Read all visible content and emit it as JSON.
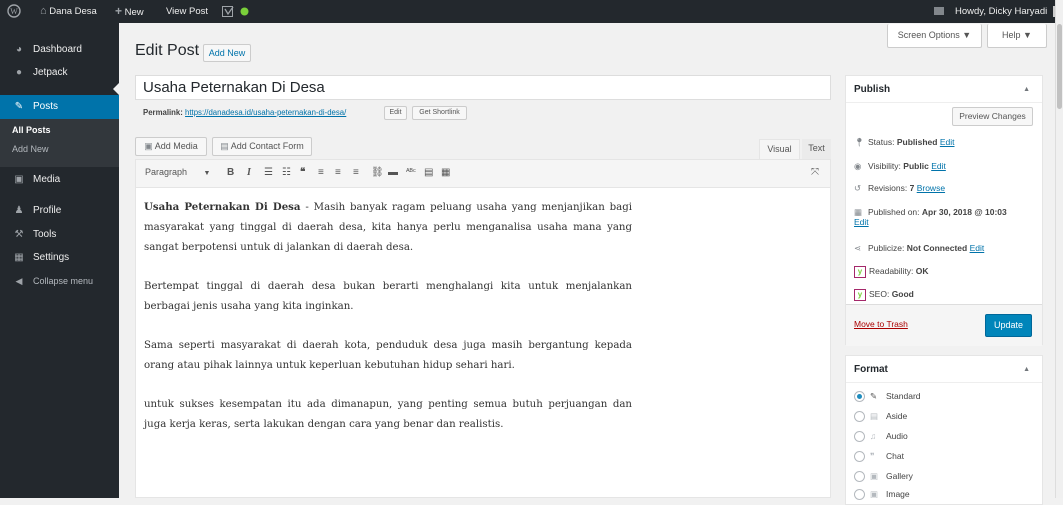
{
  "admin_bar": {
    "site_name": "Dana Desa",
    "new_label": "New",
    "view_post_label": "View Post",
    "greeting": "Howdy, Dicky Haryadi"
  },
  "sidebar": {
    "items": [
      {
        "label": "Dashboard",
        "icon": "dashboard-icon"
      },
      {
        "label": "Jetpack",
        "icon": "jetpack-icon"
      },
      {
        "label": "Posts",
        "icon": "pin-icon"
      },
      {
        "label": "Media",
        "icon": "media-icon"
      },
      {
        "label": "Profile",
        "icon": "user-icon"
      },
      {
        "label": "Tools",
        "icon": "wrench-icon"
      },
      {
        "label": "Settings",
        "icon": "settings-icon"
      },
      {
        "label": "Collapse menu",
        "icon": "collapse-icon"
      }
    ],
    "submenu": [
      "All Posts",
      "Add New"
    ]
  },
  "header": {
    "screen_options": "Screen Options ▼",
    "help": "Help ▼",
    "page_title": "Edit Post",
    "add_new": "Add New"
  },
  "post": {
    "title": "Usaha Peternakan Di Desa",
    "permalink_label": "Permalink:",
    "permalink_url": "https://danadesa.id/usaha-peternakan-di-desa/",
    "edit_label": "Edit",
    "shortlink_label": "Get Shortlink"
  },
  "editor": {
    "add_media": "Add Media",
    "add_contact_form": "Add Contact Form",
    "tab_visual": "Visual",
    "tab_text": "Text",
    "format_select": "Paragraph",
    "paragraphs": [
      {
        "bold": "Usaha Peternakan Di Desa",
        "text": " - Masih banyak ragam peluang usaha yang menjanjikan bagi masyarakat yang tinggal di daerah desa, kita hanya perlu menganalisa usaha mana yang sangat berpotensi untuk di jalankan di daerah desa."
      },
      {
        "bold": "",
        "text": "Bertempat tinggal di daerah desa bukan berarti menghalangi kita untuk menjalankan berbagai jenis usaha yang kita inginkan."
      },
      {
        "bold": "",
        "text": "Sama seperti masyarakat di daerah kota, penduduk desa juga masih bergantung kepada orang atau pihak lainnya untuk keperluan kebutuhan hidup sehari hari."
      },
      {
        "bold": "",
        "text": "untuk sukses kesempatan itu ada dimanapun, yang penting semua butuh perjuangan dan juga kerja keras, serta lakukan dengan cara yang benar dan realistis."
      }
    ]
  },
  "publish": {
    "title": "Publish",
    "preview": "Preview Changes",
    "status_label": "Status:",
    "status_value": "Published",
    "visibility_label": "Visibility:",
    "visibility_value": "Public",
    "revisions_label": "Revisions:",
    "revisions_value": "7",
    "browse": "Browse",
    "published_on_label": "Published on:",
    "published_on_value": "Apr 30, 2018 @ 10:03",
    "publicize_label": "Publicize:",
    "publicize_value": "Not Connected",
    "readability_label": "Readability:",
    "readability_value": "OK",
    "seo_label": "SEO:",
    "seo_value": "Good",
    "edit": "Edit",
    "trash": "Move to Trash",
    "update": "Update"
  },
  "format": {
    "title": "Format",
    "options": [
      {
        "label": "Standard",
        "selected": true
      },
      {
        "label": "Aside",
        "selected": false
      },
      {
        "label": "Audio",
        "selected": false
      },
      {
        "label": "Chat",
        "selected": false
      },
      {
        "label": "Gallery",
        "selected": false
      },
      {
        "label": "Image",
        "selected": false
      }
    ]
  },
  "colors": {
    "admin_bg": "#23282d",
    "accent": "#0073aa",
    "update_button": "#0085ba",
    "trash": "#a00"
  }
}
